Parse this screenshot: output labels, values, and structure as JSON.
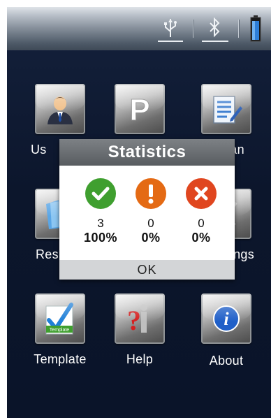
{
  "status_bar": {
    "icons": [
      "usb-icon",
      "bluetooth-icon",
      "battery-icon"
    ]
  },
  "apps": [
    {
      "label": "User",
      "icon": "user-icon"
    },
    {
      "label": "P",
      "icon": "parking-icon"
    },
    {
      "label": "Scan",
      "icon": "scan-icon"
    },
    {
      "label": "Result",
      "icon": "result-icon"
    },
    {
      "label": "Settings",
      "icon": "settings-icon"
    },
    {
      "label": "Template",
      "icon": "template-icon"
    },
    {
      "label": "Help",
      "icon": "help-icon"
    },
    {
      "label": "About",
      "icon": "info-icon"
    }
  ],
  "visible_labels": {
    "user": "Us",
    "scan": "an",
    "result": "Res",
    "settings": "tings",
    "template": "Template",
    "help": "Help",
    "about": "About"
  },
  "dialog": {
    "title": "Statistics",
    "stats": [
      {
        "type": "pass",
        "icon": "check-icon",
        "color": "#3f9f2f",
        "count": "3",
        "percent": "100%"
      },
      {
        "type": "warning",
        "icon": "exclamation-icon",
        "color": "#e46a14",
        "count": "0",
        "percent": "0%"
      },
      {
        "type": "fail",
        "icon": "x-icon",
        "color": "#e0461f",
        "count": "0",
        "percent": "0%"
      }
    ],
    "ok_label": "OK"
  },
  "colors": {
    "background": "#0c162c",
    "dialog_title_bar": "#6a6e72",
    "ok_bar": "#d3d5d7"
  }
}
